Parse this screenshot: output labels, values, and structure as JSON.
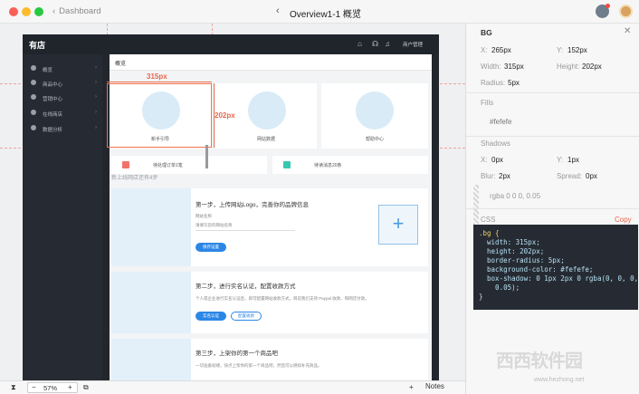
{
  "titlebar": {
    "back_label": "Dashboard",
    "doc_title": "Overview1-1 概览",
    "prev_icon": "chevron-left-icon",
    "next_icon": "chevron-right-icon"
  },
  "app": {
    "logo": "有店",
    "header_user": "商户管理",
    "sidebar": [
      {
        "label": "概览"
      },
      {
        "label": "商品中心"
      },
      {
        "label": "营销中心"
      },
      {
        "label": "在线商店"
      },
      {
        "label": "数据分析"
      }
    ],
    "page_title": "概览",
    "cards": [
      {
        "label": "新手引导"
      },
      {
        "label": "网站数据"
      },
      {
        "label": "帮助中心"
      }
    ],
    "notices": [
      {
        "text": "待处理订单1笔",
        "color": "#f0726a"
      },
      {
        "text": "待读消息20条",
        "color": "#36c9b0"
      }
    ],
    "section_title": "新上线网店还有4步",
    "steps": [
      {
        "title": "第一步，上传网站Logo，完善你的品牌信息",
        "field_label": "网站名称",
        "placeholder": "请填写您的网站名称",
        "button": "保存设置"
      },
      {
        "title": "第二步，进行实名认证，配置收款方式",
        "desc": "个人或企业进行实名认证后，即可配置网站收款方式，目前我们支持 Paypal 收款、和网店付款。",
        "button_primary": "实名认证",
        "button_secondary": "配置收款"
      },
      {
        "title": "第三步，上架你的第一个商品吧",
        "desc": "一切准备就绪，快点上架你的第一个商品吧，然后可以继续补充商品。"
      }
    ]
  },
  "measure": {
    "width_label": "315px",
    "height_label": "202px"
  },
  "bottombar": {
    "zoom": "57%",
    "notes": "Notes"
  },
  "inspector": {
    "title": "BG",
    "x_label": "X:",
    "x_value": "265px",
    "y_label": "Y:",
    "y_value": "152px",
    "width_label": "Width:",
    "width_value": "315px",
    "height_label": "Height:",
    "height_value": "202px",
    "radius_label": "Radius:",
    "radius_value": "5px",
    "fills_title": "Fills",
    "fill_value": "#fefefe",
    "shadows_title": "Shadows",
    "sx_label": "X:",
    "sx_value": "0px",
    "sy_label": "Y:",
    "sy_value": "1px",
    "blur_label": "Blur:",
    "blur_value": "2px",
    "spread_label": "Spread:",
    "spread_value": "0px",
    "shadow_color": "rgba 0 0 0, 0.05",
    "css_title": "CSS",
    "copy_label": "Copy",
    "css_selector": ".bg {",
    "css_lines": [
      "  width: 315px;",
      "  height: 202px;",
      "  border-radius: 5px;",
      "  background-color: #fefefe;",
      "  box-shadow: 0 1px 2px 0 rgba(0, 0, 0,",
      "    0.05);"
    ],
    "css_close": "}"
  },
  "watermark": {
    "brand": "西西软件园",
    "url": "www.hezhong.net"
  },
  "colors": {
    "accent": "#2c86e6",
    "measure": "#e8674b",
    "sidebar_bg": "#262b33"
  }
}
